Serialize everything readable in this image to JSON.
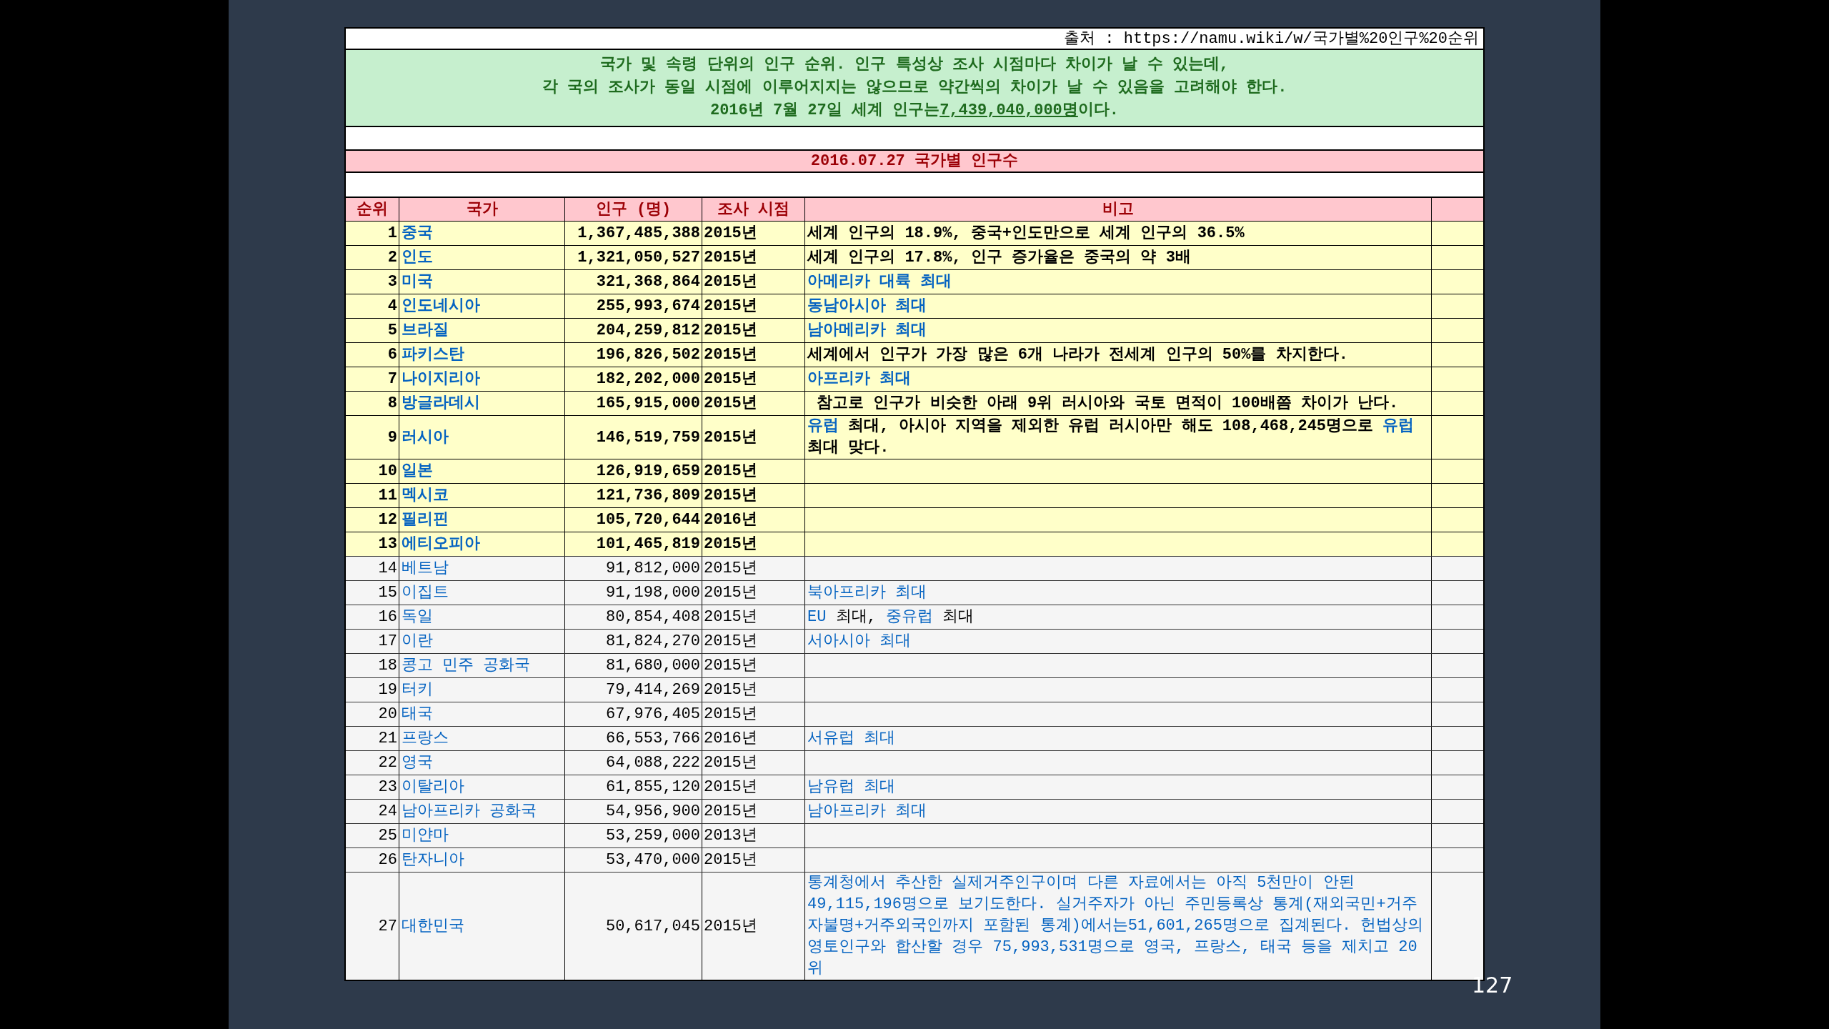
{
  "source": "출처 : https://namu.wiki/w/국가별%20인구%20순위",
  "intro": [
    [
      {
        "text": "국가 및 속령 단위의 인구 순위. 인구 특성상 조사 시점마다 차이가 날 수 있는데,"
      }
    ],
    [
      {
        "text": "각 국의 조사가 동일 시점에 이루어지지는 않으므로 약간씩의 차이가 날 수 있음을 고려해야 한다."
      }
    ],
    [
      {
        "text": "2016년 7월 27일 세계 인구는"
      },
      {
        "text": "7,439,040,000명",
        "link": true
      },
      {
        "text": "이다."
      }
    ]
  ],
  "title": "2016.07.27 국가별 인구수",
  "columns": [
    "순위",
    "국가",
    "인구 (명)",
    "조사 시점",
    "비고"
  ],
  "rows": [
    {
      "rank": "1",
      "country": "중국",
      "population": "1,367,485,388",
      "year": "2015년",
      "highlighted": true,
      "note": [
        {
          "text": "세계 인구의 18.9%, 중국+인도만으로 세계 인구의 36.5%"
        }
      ]
    },
    {
      "rank": "2",
      "country": "인도",
      "population": "1,321,050,527",
      "year": "2015년",
      "highlighted": true,
      "note": [
        {
          "text": "세계 인구의 17.8%, 인구 증가율은 중국의 약 3배"
        }
      ]
    },
    {
      "rank": "3",
      "country": "미국",
      "population": "321,368,864",
      "year": "2015년",
      "highlighted": true,
      "note": [
        {
          "text": "아메리카 대륙 최대",
          "link": true
        }
      ]
    },
    {
      "rank": "4",
      "country": "인도네시아",
      "population": "255,993,674",
      "year": "2015년",
      "highlighted": true,
      "note": [
        {
          "text": "동남아시아 최대",
          "link": true
        }
      ]
    },
    {
      "rank": "5",
      "country": "브라질",
      "population": "204,259,812",
      "year": "2015년",
      "highlighted": true,
      "note": [
        {
          "text": "남아메리카 최대",
          "link": true
        }
      ]
    },
    {
      "rank": "6",
      "country": "파키스탄",
      "population": "196,826,502",
      "year": "2015년",
      "highlighted": true,
      "note": [
        {
          "text": "세계에서 인구가 가장 많은 6개 나라가 전세계 인구의 50%를 차지한다."
        }
      ]
    },
    {
      "rank": "7",
      "country": "나이지리아",
      "population": "182,202,000",
      "year": "2015년",
      "highlighted": true,
      "note": [
        {
          "text": "아프리카 최대",
          "link": true
        }
      ]
    },
    {
      "rank": "8",
      "country": "방글라데시",
      "population": "165,915,000",
      "year": "2015년",
      "highlighted": true,
      "note": [
        {
          "text": " 참고로 인구가 비슷한 아래 9위 러시아와 국토 면적이 100배쯤 차이가 난다."
        }
      ]
    },
    {
      "rank": "9",
      "country": "러시아",
      "population": "146,519,759",
      "year": "2015년",
      "highlighted": true,
      "note": [
        {
          "text": "유럽",
          "link": true
        },
        {
          "text": " 최대, 아시아 지역을 제외한 유럽 러시아만 해도 108,468,245명으로 "
        },
        {
          "text": "유럽",
          "link": true
        },
        {
          "text": " 최대 맞다."
        }
      ]
    },
    {
      "rank": "10",
      "country": "일본",
      "population": "126,919,659",
      "year": "2015년",
      "highlighted": true
    },
    {
      "rank": "11",
      "country": "멕시코",
      "population": "121,736,809",
      "year": "2015년",
      "highlighted": true
    },
    {
      "rank": "12",
      "country": "필리핀",
      "population": "105,720,644",
      "year": "2016년",
      "highlighted": true
    },
    {
      "rank": "13",
      "country": "에티오피아",
      "population": "101,465,819",
      "year": "2015년",
      "highlighted": true
    },
    {
      "rank": "14",
      "country": "베트남",
      "population": "91,812,000",
      "year": "2015년",
      "highlighted": false
    },
    {
      "rank": "15",
      "country": "이집트",
      "population": "91,198,000",
      "year": "2015년",
      "highlighted": false,
      "note": [
        {
          "text": "북아프리카 최대",
          "link": true
        }
      ]
    },
    {
      "rank": "16",
      "country": "독일",
      "population": "80,854,408",
      "year": "2015년",
      "highlighted": false,
      "note": [
        {
          "text": "EU",
          "link": true
        },
        {
          "text": " 최대, "
        },
        {
          "text": "중유럽",
          "link": true
        },
        {
          "text": " 최대"
        }
      ]
    },
    {
      "rank": "17",
      "country": "이란",
      "population": "81,824,270",
      "year": "2015년",
      "highlighted": false,
      "note": [
        {
          "text": "서아시아 최대",
          "link": true
        }
      ]
    },
    {
      "rank": "18",
      "country": "콩고 민주 공화국",
      "population": "81,680,000",
      "year": "2015년",
      "highlighted": false
    },
    {
      "rank": "19",
      "country": "터키",
      "population": "79,414,269",
      "year": "2015년",
      "highlighted": false
    },
    {
      "rank": "20",
      "country": "태국",
      "population": "67,976,405",
      "year": "2015년",
      "highlighted": false
    },
    {
      "rank": "21",
      "country": "프랑스",
      "population": "66,553,766",
      "year": "2016년",
      "highlighted": false,
      "note": [
        {
          "text": "서유럽 최대",
          "link": true
        }
      ]
    },
    {
      "rank": "22",
      "country": "영국",
      "population": "64,088,222",
      "year": "2015년",
      "highlighted": false
    },
    {
      "rank": "23",
      "country": "이탈리아",
      "population": "61,855,120",
      "year": "2015년",
      "highlighted": false,
      "note": [
        {
          "text": "남유럽 최대",
          "link": true
        }
      ]
    },
    {
      "rank": "24",
      "country": "남아프리카 공화국",
      "population": "54,956,900",
      "year": "2015년",
      "highlighted": false,
      "note": [
        {
          "text": "남아프리카 최대",
          "link": true
        }
      ]
    },
    {
      "rank": "25",
      "country": "미얀마",
      "population": "53,259,000",
      "year": "2013년",
      "highlighted": false
    },
    {
      "rank": "26",
      "country": "탄자니아",
      "population": "53,470,000",
      "year": "2015년",
      "highlighted": false
    },
    {
      "rank": "27",
      "country": "대한민국",
      "population": "50,617,045",
      "year": "2015년",
      "highlighted": false,
      "note": [
        {
          "text": "통계청에서 추산한 실제거주인구이며 다른 자료에서는 아직 5천만이 안된 49,115,196명으로 보기도한다. 실거주자가 아닌 주민등록상 통계(재외국민+거주자불명+거주외국인까지 포함된 통계)에서는51,601,265명으로 집계된다. 헌법상의 영토인구와 합산할 경우 75,993,531명으로 영국, 프랑스, 태국 등을 제치고 20위",
          "link": true
        }
      ]
    }
  ],
  "page_number": "127"
}
